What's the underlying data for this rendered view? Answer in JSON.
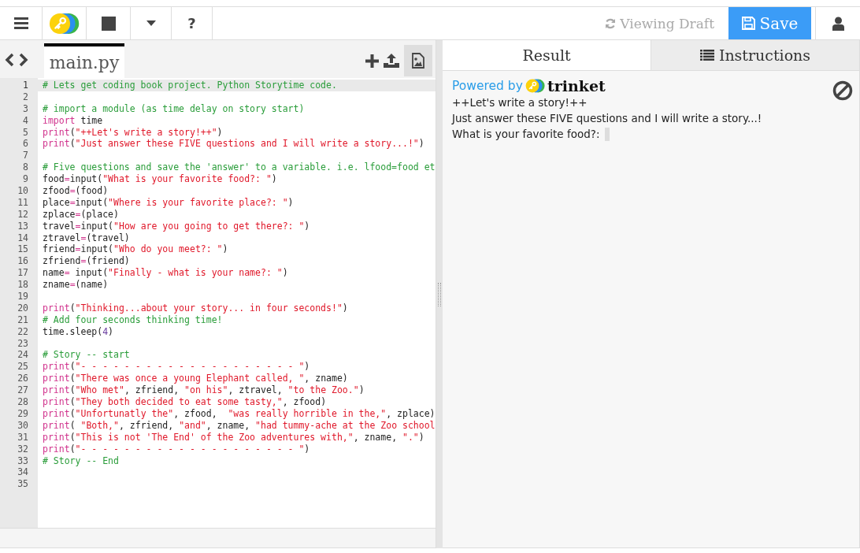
{
  "toolbar": {
    "help": "?",
    "status": "Viewing Draft",
    "save": "Save"
  },
  "editor": {
    "tabs": [
      {
        "label": "main.py",
        "selected": true
      }
    ],
    "lines": [
      {
        "number": "1",
        "current": true,
        "tokens": [
          {
            "kind": "comment",
            "text": "# Lets get coding book project. Python Storytime code."
          }
        ]
      },
      {
        "number": "2",
        "current": false
      },
      {
        "number": "3",
        "current": false,
        "tokens": [
          {
            "kind": "comment",
            "text": "# import a module (as time delay on story start)"
          }
        ]
      },
      {
        "number": "4",
        "current": false,
        "tokens": [
          {
            "kind": "keyword",
            "text": "import"
          },
          {
            "kind": "plain",
            "text": " time"
          }
        ]
      },
      {
        "number": "5",
        "current": false,
        "tokens": [
          {
            "kind": "keyword",
            "text": "print"
          },
          {
            "kind": "plain",
            "text": "("
          },
          {
            "kind": "string",
            "text": "\"++Let's write a story!++\""
          },
          {
            "kind": "plain",
            "text": ")"
          }
        ]
      },
      {
        "number": "6",
        "current": false,
        "tokens": [
          {
            "kind": "keyword",
            "text": "print"
          },
          {
            "kind": "plain",
            "text": "("
          },
          {
            "kind": "string",
            "text": "\"Just answer these FIVE questions and I will write a story...!\""
          },
          {
            "kind": "plain",
            "text": ")"
          }
        ]
      },
      {
        "number": "7",
        "current": false
      },
      {
        "number": "8",
        "current": false,
        "tokens": [
          {
            "kind": "comment",
            "text": "# Five questions and save the 'answer' to a variable. i.e. lfood=food et"
          }
        ]
      },
      {
        "number": "9",
        "current": false,
        "tokens": [
          {
            "kind": "plain",
            "text": "food"
          },
          {
            "kind": "operator",
            "text": "="
          },
          {
            "kind": "plain",
            "text": "input("
          },
          {
            "kind": "string",
            "text": "\"What is your favorite food?: \""
          },
          {
            "kind": "plain",
            "text": ")"
          }
        ]
      },
      {
        "number": "10",
        "current": false,
        "tokens": [
          {
            "kind": "plain",
            "text": "zfood"
          },
          {
            "kind": "operator",
            "text": "="
          },
          {
            "kind": "plain",
            "text": "(food)"
          }
        ]
      },
      {
        "number": "11",
        "current": false,
        "tokens": [
          {
            "kind": "plain",
            "text": "place"
          },
          {
            "kind": "operator",
            "text": "="
          },
          {
            "kind": "plain",
            "text": "input("
          },
          {
            "kind": "string",
            "text": "\"Where is your favorite place?: \""
          },
          {
            "kind": "plain",
            "text": ")"
          }
        ]
      },
      {
        "number": "12",
        "current": false,
        "tokens": [
          {
            "kind": "plain",
            "text": "zplace"
          },
          {
            "kind": "operator",
            "text": "="
          },
          {
            "kind": "plain",
            "text": "(place)"
          }
        ]
      },
      {
        "number": "13",
        "current": false,
        "tokens": [
          {
            "kind": "plain",
            "text": "travel"
          },
          {
            "kind": "operator",
            "text": "="
          },
          {
            "kind": "plain",
            "text": "input("
          },
          {
            "kind": "string",
            "text": "\"How are you going to get there?: \""
          },
          {
            "kind": "plain",
            "text": ")"
          }
        ]
      },
      {
        "number": "14",
        "current": false,
        "tokens": [
          {
            "kind": "plain",
            "text": "ztravel"
          },
          {
            "kind": "operator",
            "text": "="
          },
          {
            "kind": "plain",
            "text": "(travel)"
          }
        ]
      },
      {
        "number": "15",
        "current": false,
        "tokens": [
          {
            "kind": "plain",
            "text": "friend"
          },
          {
            "kind": "operator",
            "text": "="
          },
          {
            "kind": "plain",
            "text": "input("
          },
          {
            "kind": "string",
            "text": "\"Who do you meet?: \""
          },
          {
            "kind": "plain",
            "text": ")"
          }
        ]
      },
      {
        "number": "16",
        "current": false,
        "tokens": [
          {
            "kind": "plain",
            "text": "zfriend"
          },
          {
            "kind": "operator",
            "text": "="
          },
          {
            "kind": "plain",
            "text": "(friend)"
          }
        ]
      },
      {
        "number": "17",
        "current": false,
        "tokens": [
          {
            "kind": "plain",
            "text": "name"
          },
          {
            "kind": "operator",
            "text": "="
          },
          {
            "kind": "plain",
            "text": " input("
          },
          {
            "kind": "string",
            "text": "\"Finally - what is your name?: \""
          },
          {
            "kind": "plain",
            "text": ")"
          }
        ]
      },
      {
        "number": "18",
        "current": false,
        "tokens": [
          {
            "kind": "plain",
            "text": "zname"
          },
          {
            "kind": "operator",
            "text": "="
          },
          {
            "kind": "plain",
            "text": "(name)"
          }
        ]
      },
      {
        "number": "19",
        "current": false
      },
      {
        "number": "20",
        "current": false,
        "tokens": [
          {
            "kind": "keyword",
            "text": "print"
          },
          {
            "kind": "plain",
            "text": "("
          },
          {
            "kind": "string",
            "text": "\"Thinking...about your story... in four seconds!\""
          },
          {
            "kind": "plain",
            "text": ")"
          }
        ]
      },
      {
        "number": "21",
        "current": false,
        "tokens": [
          {
            "kind": "comment",
            "text": "# Add four seconds thinking time!"
          }
        ]
      },
      {
        "number": "22",
        "current": false,
        "tokens": [
          {
            "kind": "plain",
            "text": "time.sleep("
          },
          {
            "kind": "number",
            "text": "4"
          },
          {
            "kind": "plain",
            "text": ")"
          }
        ]
      },
      {
        "number": "23",
        "current": false
      },
      {
        "number": "24",
        "current": false,
        "tokens": [
          {
            "kind": "comment",
            "text": "# Story -- start"
          }
        ]
      },
      {
        "number": "25",
        "current": false,
        "tokens": [
          {
            "kind": "keyword",
            "text": "print"
          },
          {
            "kind": "plain",
            "text": "("
          },
          {
            "kind": "string",
            "text": "\"- - - - - - - - - - - - - - - - - - - - \""
          },
          {
            "kind": "plain",
            "text": ")"
          }
        ]
      },
      {
        "number": "26",
        "current": false,
        "tokens": [
          {
            "kind": "keyword",
            "text": "print"
          },
          {
            "kind": "plain",
            "text": "("
          },
          {
            "kind": "string",
            "text": "\"There was once a young Elephant called, \""
          },
          {
            "kind": "plain",
            "text": ", zname)"
          }
        ]
      },
      {
        "number": "27",
        "current": false,
        "tokens": [
          {
            "kind": "keyword",
            "text": "print"
          },
          {
            "kind": "plain",
            "text": "("
          },
          {
            "kind": "string",
            "text": "\"Who met\""
          },
          {
            "kind": "plain",
            "text": ", zfriend, "
          },
          {
            "kind": "string",
            "text": "\"on his\""
          },
          {
            "kind": "plain",
            "text": ", ztravel, "
          },
          {
            "kind": "string",
            "text": "\"to the Zoo.\""
          },
          {
            "kind": "plain",
            "text": ")"
          }
        ]
      },
      {
        "number": "28",
        "current": false,
        "tokens": [
          {
            "kind": "keyword",
            "text": "print"
          },
          {
            "kind": "plain",
            "text": "("
          },
          {
            "kind": "string",
            "text": "\"They both decided to eat some tasty,\""
          },
          {
            "kind": "plain",
            "text": ", zfood)"
          }
        ]
      },
      {
        "number": "29",
        "current": false,
        "tokens": [
          {
            "kind": "keyword",
            "text": "print"
          },
          {
            "kind": "plain",
            "text": "("
          },
          {
            "kind": "string",
            "text": "\"Unfortunatly the\""
          },
          {
            "kind": "plain",
            "text": ", zfood,  "
          },
          {
            "kind": "string",
            "text": "\"was really horrible in the,\""
          },
          {
            "kind": "plain",
            "text": ", zplace)"
          }
        ]
      },
      {
        "number": "30",
        "current": false,
        "tokens": [
          {
            "kind": "keyword",
            "text": "print"
          },
          {
            "kind": "plain",
            "text": "( "
          },
          {
            "kind": "string",
            "text": "\"Both,\""
          },
          {
            "kind": "plain",
            "text": ", zfriend, "
          },
          {
            "kind": "string",
            "text": "\"and\""
          },
          {
            "kind": "plain",
            "text": ", zname, "
          },
          {
            "kind": "string",
            "text": "\"had tummy-ache at the Zoo school"
          }
        ]
      },
      {
        "number": "31",
        "current": false,
        "tokens": [
          {
            "kind": "keyword",
            "text": "print"
          },
          {
            "kind": "plain",
            "text": "("
          },
          {
            "kind": "string",
            "text": "\"This is not 'The End' of the Zoo adventures with,\""
          },
          {
            "kind": "plain",
            "text": ", zname, "
          },
          {
            "kind": "string",
            "text": "\".\""
          },
          {
            "kind": "plain",
            "text": ")"
          }
        ]
      },
      {
        "number": "32",
        "current": false,
        "tokens": [
          {
            "kind": "keyword",
            "text": "print"
          },
          {
            "kind": "plain",
            "text": "("
          },
          {
            "kind": "string",
            "text": "\"- - - - - - - - - - - - - - - - - - - - \""
          },
          {
            "kind": "plain",
            "text": ")"
          }
        ]
      },
      {
        "number": "33",
        "current": false,
        "tokens": [
          {
            "kind": "comment",
            "text": "# Story -- End"
          }
        ]
      },
      {
        "number": "34",
        "current": false
      },
      {
        "number": "35",
        "current": false
      }
    ]
  },
  "output": {
    "tabs": [
      {
        "label": "Result",
        "selected": true,
        "kind": "plain"
      },
      {
        "label": "Instructions",
        "selected": false,
        "kind": "list"
      }
    ],
    "powered_by": "Powered by",
    "brand": "trinket",
    "lines": [
      "++Let's write a story!++",
      "Just answer these FIVE questions and I will write a story...!"
    ],
    "prompt": "What is your favorite food?:"
  }
}
